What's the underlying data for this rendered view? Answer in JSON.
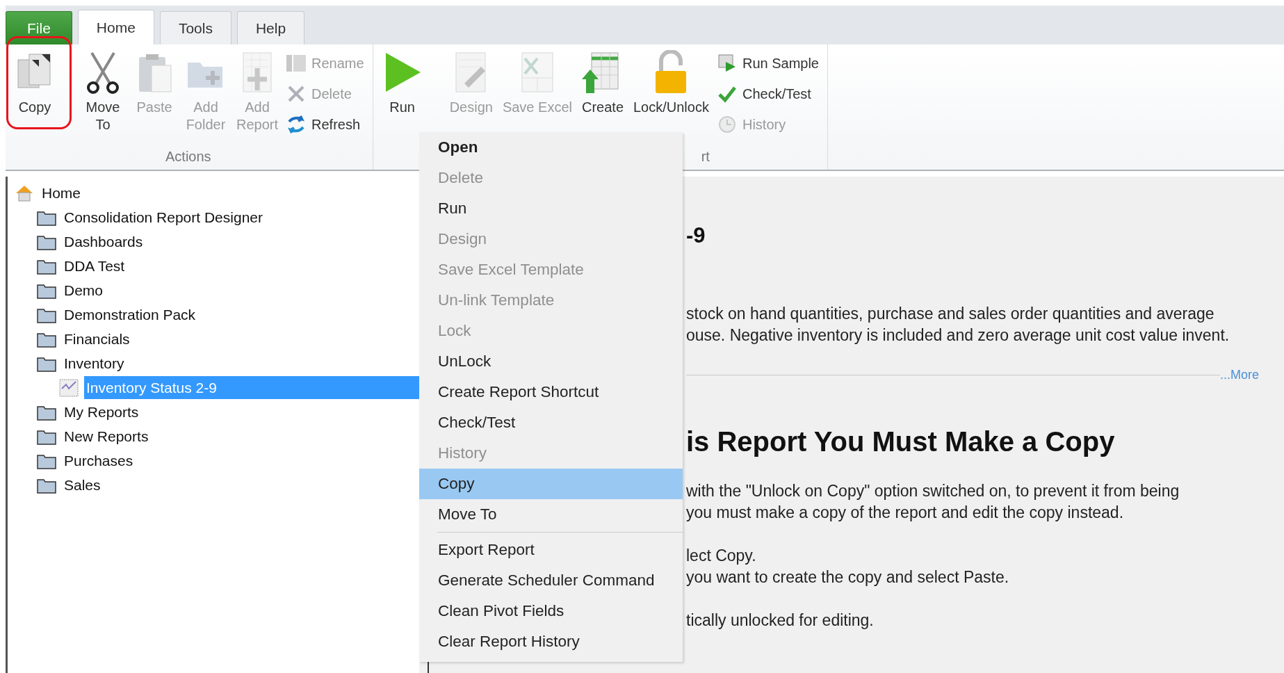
{
  "ribbon_tabs": [
    {
      "label": "File",
      "kind": "file",
      "selected": false
    },
    {
      "label": "Home",
      "kind": "tab",
      "selected": true
    },
    {
      "label": "Tools",
      "kind": "tab",
      "selected": false
    },
    {
      "label": "Help",
      "kind": "tab",
      "selected": false
    }
  ],
  "ribbon_groups": [
    {
      "label": "Actions",
      "items": [
        {
          "kind": "large",
          "lines": [
            "Copy"
          ],
          "disabled": false,
          "highlighted": true
        },
        {
          "kind": "large",
          "lines": [
            "Move",
            "To"
          ],
          "disabled": false
        },
        {
          "kind": "large",
          "lines": [
            "Paste"
          ],
          "disabled": true
        },
        {
          "kind": "large",
          "lines": [
            "Add",
            "Folder"
          ],
          "disabled": true
        },
        {
          "kind": "large",
          "lines": [
            "Add",
            "Report"
          ],
          "disabled": true
        },
        {
          "kind": "small",
          "lines": [
            "Rename"
          ],
          "disabled": true
        },
        {
          "kind": "small",
          "lines": [
            "Delete"
          ],
          "disabled": true
        },
        {
          "kind": "small",
          "lines": [
            "Refresh"
          ],
          "disabled": false
        }
      ]
    },
    {
      "label": "rt",
      "items": [
        {
          "kind": "large",
          "lines": [
            "Run"
          ],
          "disabled": false
        },
        {
          "kind": "large",
          "lines": [
            "Design"
          ],
          "disabled": true
        },
        {
          "kind": "large",
          "lines": [
            "Save Excel"
          ],
          "disabled": true
        },
        {
          "kind": "large",
          "lines": [
            "Create"
          ],
          "disabled": false
        },
        {
          "kind": "large",
          "lines": [
            "Lock/Unlock"
          ],
          "disabled": false
        },
        {
          "kind": "small",
          "lines": [
            "Run Sample"
          ],
          "disabled": false
        },
        {
          "kind": "small",
          "lines": [
            "Check/Test"
          ],
          "disabled": false
        },
        {
          "kind": "small",
          "lines": [
            "History"
          ],
          "disabled": true
        }
      ]
    }
  ],
  "tree": [
    {
      "label": "Home",
      "kind": "home",
      "selected": false,
      "children": [
        {
          "label": "Consolidation Report Designer",
          "kind": "folder",
          "selected": false
        },
        {
          "label": "Dashboards",
          "kind": "folder",
          "selected": false
        },
        {
          "label": "DDA Test",
          "kind": "folder",
          "selected": false
        },
        {
          "label": "Demo",
          "kind": "folder",
          "selected": false
        },
        {
          "label": "Demonstration Pack",
          "kind": "folder",
          "selected": false
        },
        {
          "label": "Financials",
          "kind": "folder",
          "selected": false
        },
        {
          "label": "Inventory",
          "kind": "folder",
          "selected": false,
          "children": [
            {
              "label": "Inventory Status 2-9",
              "kind": "report",
              "selected": true
            }
          ]
        },
        {
          "label": "My Reports",
          "kind": "folder",
          "selected": false
        },
        {
          "label": "New Reports",
          "kind": "folder",
          "selected": false
        },
        {
          "label": "Purchases",
          "kind": "folder",
          "selected": false
        },
        {
          "label": "Sales",
          "kind": "folder",
          "selected": false
        }
      ]
    }
  ],
  "context_menu": {
    "sections": [
      {
        "items": [
          {
            "label": "Open",
            "default": true,
            "disabled": false,
            "selected": false
          },
          {
            "label": "Delete",
            "default": false,
            "disabled": true,
            "selected": false
          },
          {
            "label": "Run",
            "default": false,
            "disabled": false,
            "selected": false
          },
          {
            "label": "Design",
            "default": false,
            "disabled": true,
            "selected": false
          },
          {
            "label": "Save Excel Template",
            "default": false,
            "disabled": true,
            "selected": false
          },
          {
            "label": "Un-link Template",
            "default": false,
            "disabled": true,
            "selected": false
          },
          {
            "label": "Lock",
            "default": false,
            "disabled": true,
            "selected": false
          },
          {
            "label": "UnLock",
            "default": false,
            "disabled": false,
            "selected": false
          },
          {
            "label": "Create Report Shortcut",
            "default": false,
            "disabled": false,
            "selected": false
          },
          {
            "label": "Check/Test",
            "default": false,
            "disabled": false,
            "selected": false
          },
          {
            "label": "History",
            "default": false,
            "disabled": true,
            "selected": false
          },
          {
            "label": "Copy",
            "default": false,
            "disabled": false,
            "selected": true
          },
          {
            "label": "Move To",
            "default": false,
            "disabled": false,
            "selected": false
          }
        ]
      },
      {
        "items": [
          {
            "label": "Export Report",
            "default": false,
            "disabled": false,
            "selected": false
          },
          {
            "label": "Generate Scheduler Command",
            "default": false,
            "disabled": false,
            "selected": false
          },
          {
            "label": "Clean Pivot Fields",
            "default": false,
            "disabled": false,
            "selected": false
          },
          {
            "label": "Clear Report History",
            "default": false,
            "disabled": false,
            "selected": false
          }
        ]
      }
    ]
  },
  "details": {
    "title": "-9",
    "description_lines": [
      "stock on hand quantities, purchase and sales order quantities and average",
      "ouse. Negative inventory is included and zero average unit cost value invent."
    ],
    "more_link": "...More",
    "heading": "is Report You Must Make a Copy",
    "paragraphs": [
      [
        "with the \"Unlock on Copy\" option switched on, to prevent it from being",
        "you must make a copy of the report and edit the copy instead."
      ],
      [
        "lect Copy.",
        "you want to create the copy and select Paste."
      ],
      [
        "tically unlocked for editing."
      ]
    ]
  }
}
